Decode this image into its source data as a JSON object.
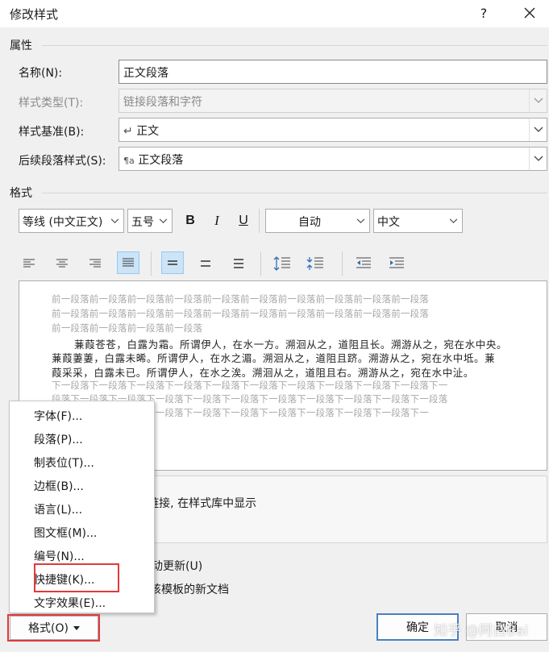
{
  "dialog": {
    "title": "修改样式",
    "help": "?",
    "close_icon": "close-icon"
  },
  "sections": {
    "properties": "属性",
    "format": "格式"
  },
  "fields": {
    "name_label": "名称(N):",
    "name_value": "正文段落",
    "style_type_label": "样式类型(T):",
    "style_type_value": "链接段落和字符",
    "based_on_label": "样式基准(B):",
    "based_on_value": "正文",
    "based_on_icon": "↵",
    "next_label": "后续段落样式(S):",
    "next_value": "正文段落",
    "next_icon": "¶a"
  },
  "toolbar": {
    "font": "等线 (中文正文)",
    "size": "五号",
    "bold": "B",
    "italic": "I",
    "underline": "U",
    "color": "自动",
    "language": "中文"
  },
  "preview": {
    "prev_lines": [
      "前一段落前一段落前一段落前一段落前一段落前一段落前一段落前一段落前一段落前一段落",
      "前一段落前一段落前一段落前一段落前一段落前一段落前一段落前一段落前一段落前一段落",
      "前一段落前一段落前一段落前一段落"
    ],
    "main_lines": [
      "蒹葭苍苍，白露为霜。所谓伊人，在水一方。溯洄从之，道阻且长。溯游从之，宛在水中央。",
      "蒹葭萋萋，白露未晞。所谓伊人，在水之湄。溯洄从之，道阻且跻。溯游从之，宛在水中坻。蒹",
      "葭采采，白露未已。所谓伊人，在水之涘。溯洄从之，道阻且右。溯游从之，宛在水中沚。"
    ],
    "next_lines": [
      "下一段落下一段落下一段落下一段落下一段落下一段落下一段落下一段落下一段落下一段落下一",
      "段落下一段落下一段落下一段落下一段落下一段落下一段落下一段落下一段落下一段落下一段落",
      "段落下一段落下一段落下一段落下一段落下一段落下一段落下一段落下一段落下一段落下一"
    ]
  },
  "description": "式: 链接, 在样式库中显示",
  "options": {
    "auto_update": "动更新(U)",
    "new_docs": "该模板的新文档"
  },
  "buttons": {
    "format": "格式(O)",
    "ok": "确定",
    "cancel": "取消"
  },
  "menu": {
    "items": [
      "字体(F)...",
      "段落(P)...",
      "制表位(T)...",
      "边框(B)...",
      "语言(L)...",
      "图文框(M)...",
      "编号(N)...",
      "快捷键(K)...",
      "文字效果(E)..."
    ]
  },
  "watermark": "知乎 @阿白Bai",
  "colors": {
    "highlight": "#e03a3a",
    "active_toggle": "#cce4f7",
    "primary_border": "#4a7fc4"
  }
}
